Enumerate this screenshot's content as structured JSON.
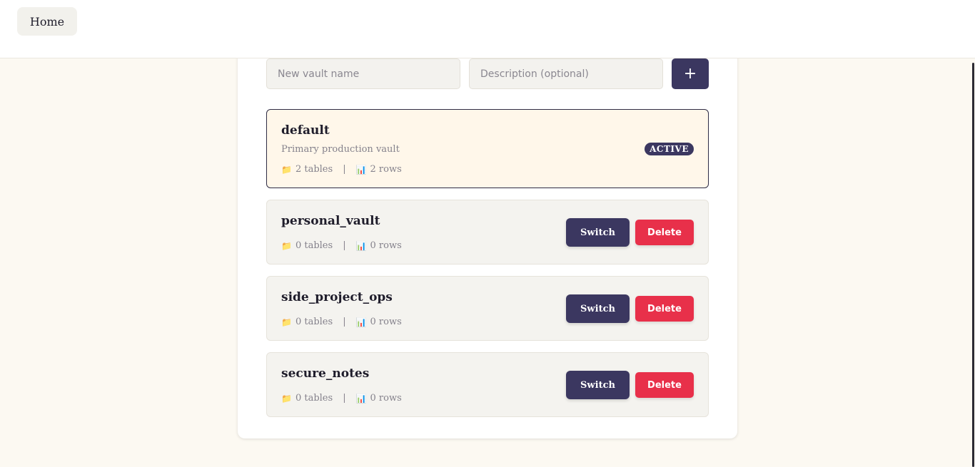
{
  "header": {
    "home_label": "Home"
  },
  "form": {
    "name_placeholder": "New vault name",
    "name_value": "",
    "description_placeholder": "Description (optional)",
    "description_value": "",
    "add_label": "+"
  },
  "vaults": [
    {
      "name": "default",
      "description": "Primary production vault",
      "tables": "2 tables",
      "rows": "2 rows",
      "badge": "ACTIVE"
    },
    {
      "name": "personal_vault",
      "tables": "0 tables",
      "rows": "0 rows",
      "switch_label": "Switch",
      "delete_label": "Delete"
    },
    {
      "name": "side_project_ops",
      "tables": "0 tables",
      "rows": "0 rows",
      "switch_label": "Switch",
      "delete_label": "Delete"
    },
    {
      "name": "secure_notes",
      "tables": "0 tables",
      "rows": "0 rows",
      "switch_label": "Switch",
      "delete_label": "Delete"
    }
  ],
  "separator": "|",
  "icons": {
    "tables": "folder-icon",
    "rows": "bar-chart-icon"
  },
  "colors": {
    "accent": "#3b3760",
    "danger": "#e8304a",
    "active_card_bg": "#fff7ea",
    "page_bg": "#fcf9f2"
  }
}
